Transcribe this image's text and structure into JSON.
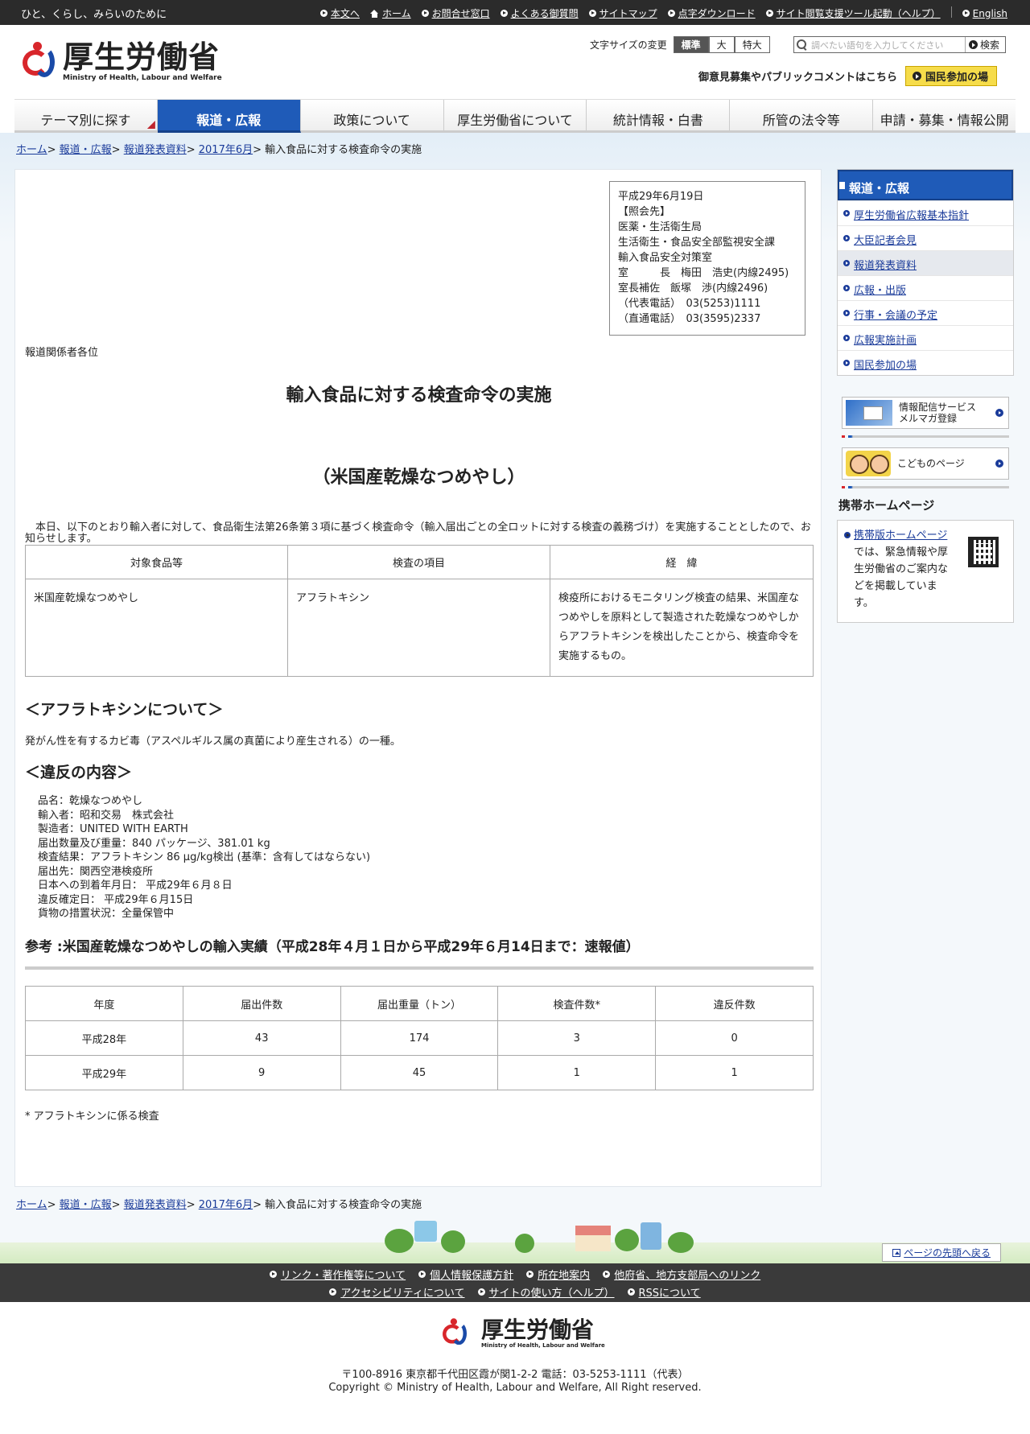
{
  "topbar": {
    "slogan": "ひと、くらし、みらいのために",
    "links": [
      "本文へ",
      "ホーム",
      "お問合せ窓口",
      "よくある御質問",
      "サイトマップ",
      "点字ダウンロード",
      "サイト閲覧支援ツール起動（ヘルプ）",
      "English"
    ]
  },
  "header": {
    "logo_ja": "厚生労働省",
    "logo_en": "Ministry of Health, Labour and Welfare",
    "fontsize_label": "文字サイズの変更",
    "fontsize_options": [
      "標準",
      "大",
      "特大"
    ],
    "search_placeholder": "調べたい語句を入力してください",
    "search_button": "検索",
    "public_comment_text": "御意見募集やパブリックコメントはこちら",
    "kokumin_button": "国民参加の場"
  },
  "nav": {
    "tabs": [
      "テーマ別に探す",
      "報道・広報",
      "政策について",
      "厚生労働省について",
      "統計情報・白書",
      "所管の法令等",
      "申請・募集・情報公開"
    ],
    "active": "報道・広報"
  },
  "breadcrumb": {
    "items": [
      "ホーム",
      "報道・広報",
      "報道発表資料",
      "2017年6月"
    ],
    "current": "輸入食品に対する検査命令の実施"
  },
  "contact": {
    "lines": [
      "平成29年6月19日",
      "【照会先】",
      "医薬・生活衛生局",
      "生活衛生・食品安全部監視安全課",
      "輸入食品安全対策室",
      "室　　　長　梅田　浩史(内線2495)",
      "室長補佐　飯塚　渉(内線2496)",
      "（代表電話）　03(5253)1111",
      "（直通電話）　03(3595)2337"
    ]
  },
  "main": {
    "addressee": "報道関係者各位",
    "title": "輸入食品に対する検査命令の実施",
    "subtitle": "（米国産乾燥なつめやし）",
    "intro": "　本日、以下のとおり輸入者に対して、食品衛生法第26条第３項に基づく検査命令（輸入届出ごとの全ロットに対する検査の義務づけ）を実施することとしたので、お知らせします。",
    "table1": {
      "headers": [
        "対象食品等",
        "検査の項目",
        "経　緯"
      ],
      "row": [
        "米国産乾燥なつめやし",
        "アフラトキシン",
        "検疫所におけるモニタリング検査の結果、米国産なつめやしを原料として製造された乾燥なつめやしからアフラトキシンを検出したことから、検査命令を実施するもの。"
      ]
    },
    "aflatoxin_heading": "＜アフラトキシンについて＞",
    "aflatoxin_text": "発がん性を有するカビ毒（アスペルギルス属の真菌により産生される）の一種。",
    "violation_heading": "＜違反の内容＞",
    "violation_lines": [
      "品名：乾燥なつめやし",
      "輸入者：昭和交易　株式会社",
      "製造者：UNITED WITH EARTH",
      "届出数量及び重量：840 パッケージ、381.01 kg",
      "検査結果：アフラトキシン 86 μg/kg検出 (基準：含有してはならない)",
      "届出先：関西空港検疫所",
      "日本への到着年月日： 平成29年６月８日",
      "違反確定日： 平成29年６月15日",
      "貨物の措置状況：全量保管中"
    ],
    "reference_heading": "参考 :米国産乾燥なつめやしの輸入実績（平成28年４月１日から平成29年６月14日まで：速報値）",
    "table2": {
      "headers": [
        "年度",
        "届出件数",
        "届出重量（トン）",
        "検査件数*",
        "違反件数"
      ],
      "rows": [
        [
          "平成28年",
          "43",
          "174",
          "3",
          "0"
        ],
        [
          "平成29年",
          "9",
          "45",
          "1",
          "1"
        ]
      ]
    },
    "footnote": "* アフラトキシンに係る検査"
  },
  "sidebar": {
    "heading": "報道・広報",
    "items": [
      "厚生労働省広報基本指針",
      "大臣記者会見",
      "報道発表資料",
      "広報・出版",
      "行事・会議の予定",
      "広報実施計画",
      "国民参加の場"
    ],
    "active": "報道発表資料",
    "banner_mail_line1": "情報配信サービス",
    "banner_mail_line2": "メルマガ登録",
    "banner_kids": "こどものページ",
    "mobile_heading": "携帯ホームページ",
    "mobile_link": "携帯版ホームページ",
    "mobile_text": "では、緊急情報や厚生労働省のご案内などを掲載しています。"
  },
  "footer": {
    "back_to_top": "ページの先頭へ戻る",
    "links_row1": [
      "リンク・著作権等について",
      "個人情報保護方針",
      "所在地案内",
      "他府省、地方支部局へのリンク"
    ],
    "links_row2": [
      "アクセシビリティについて",
      "サイトの使い方（ヘルプ）",
      "RSSについて"
    ],
    "logo_ja": "厚生労働省",
    "logo_en": "Ministry of Health, Labour and Welfare",
    "address": "〒100-8916 東京都千代田区霞が関1-2-2 電話：03-5253-1111（代表）",
    "copyright": "Copyright © Ministry of Health, Labour and Welfare, All Right reserved."
  },
  "colors": {
    "nav_active": "#1f5bb8",
    "topbar": "#2b2b2b",
    "link": "#1a3b9a",
    "kokumin": "#f6dc4a"
  }
}
